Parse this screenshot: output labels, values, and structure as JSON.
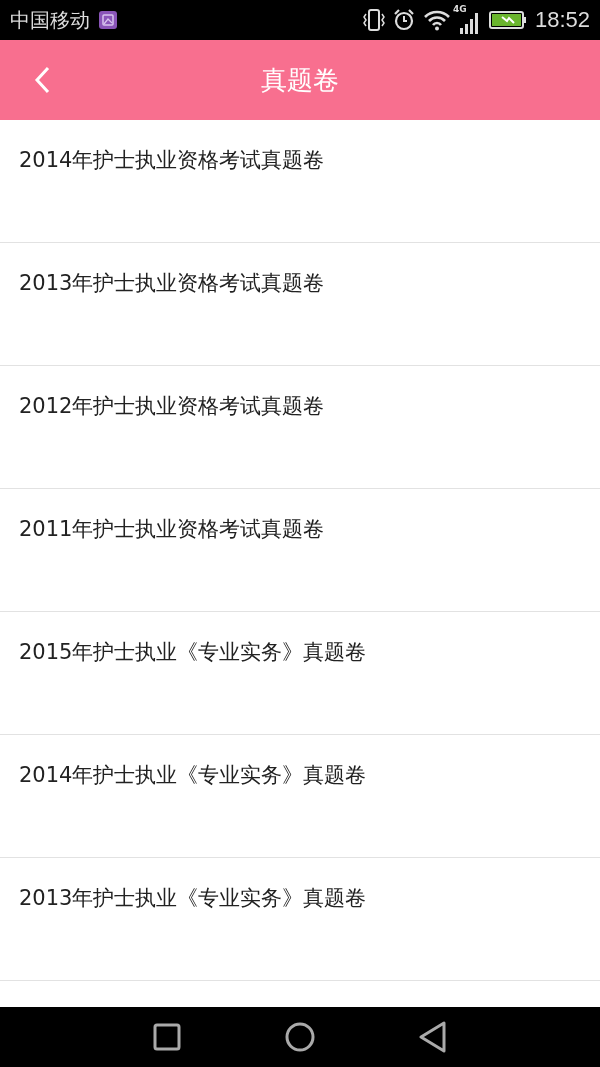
{
  "status_bar": {
    "carrier": "中国移动",
    "network": "4G",
    "time": "18:52"
  },
  "header": {
    "title": "真题卷"
  },
  "items": [
    {
      "title": "2014年护士执业资格考试真题卷"
    },
    {
      "title": "2013年护士执业资格考试真题卷"
    },
    {
      "title": "2012年护士执业资格考试真题卷"
    },
    {
      "title": "2011年护士执业资格考试真题卷"
    },
    {
      "title": "2015年护士执业《专业实务》真题卷"
    },
    {
      "title": "2014年护士执业《专业实务》真题卷"
    },
    {
      "title": "2013年护士执业《专业实务》真题卷"
    }
  ]
}
